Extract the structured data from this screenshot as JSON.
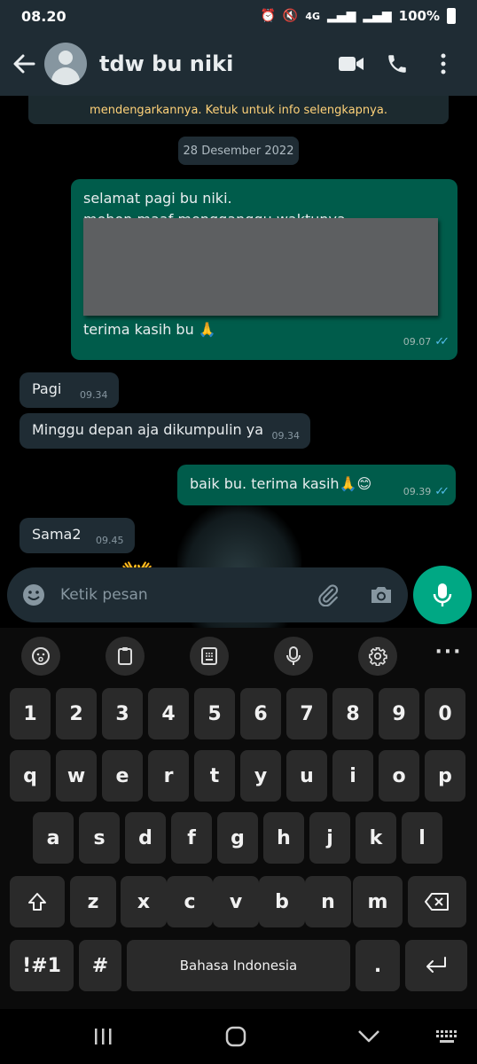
{
  "status_bar": {
    "time": "08.20",
    "network": "4G",
    "battery": "100%"
  },
  "header": {
    "contact_name": "tdw bu niki"
  },
  "chat": {
    "system_notice": "mendengarkannya. Ketuk untuk info selengkapnya.",
    "date_chip": "28 Desember 2022",
    "messages": [
      {
        "direction": "out",
        "lines": [
          "selamat pagi bu niki.",
          "mohon maaf mengganggu waktunya."
        ],
        "last_line": "terima kasih bu 🙏",
        "time": "09.07"
      },
      {
        "direction": "in",
        "text": "Pagi",
        "time": "09.34"
      },
      {
        "direction": "in",
        "text": "Minggu depan aja dikumpulin ya",
        "time": "09.34"
      },
      {
        "direction": "out",
        "text": "baik bu. terima kasih🙏😊",
        "time": "09.39"
      },
      {
        "direction": "in",
        "text": "Sama2",
        "time": "09.45"
      }
    ],
    "wave_emoji": "👐"
  },
  "input": {
    "placeholder": "Ketik pesan"
  },
  "keyboard": {
    "row_numbers": [
      "1",
      "2",
      "3",
      "4",
      "5",
      "6",
      "7",
      "8",
      "9",
      "0"
    ],
    "row_top": [
      "q",
      "w",
      "e",
      "r",
      "t",
      "y",
      "u",
      "i",
      "o",
      "p"
    ],
    "row_mid": [
      "a",
      "s",
      "d",
      "f",
      "g",
      "h",
      "j",
      "k",
      "l"
    ],
    "row_bottom": [
      "z",
      "x",
      "c",
      "v",
      "b",
      "n",
      "m"
    ],
    "symbols_key": "!#1",
    "hash_key": "#",
    "space_label": "Bahasa Indonesia",
    "period_key": "."
  },
  "colors": {
    "header_bg": "#1f2c34",
    "outgoing_bubble": "#005c4b",
    "incoming_bubble": "#1f2c34",
    "accent": "#00a884",
    "read_tick": "#53bdeb",
    "notice_text": "#ffd279"
  }
}
